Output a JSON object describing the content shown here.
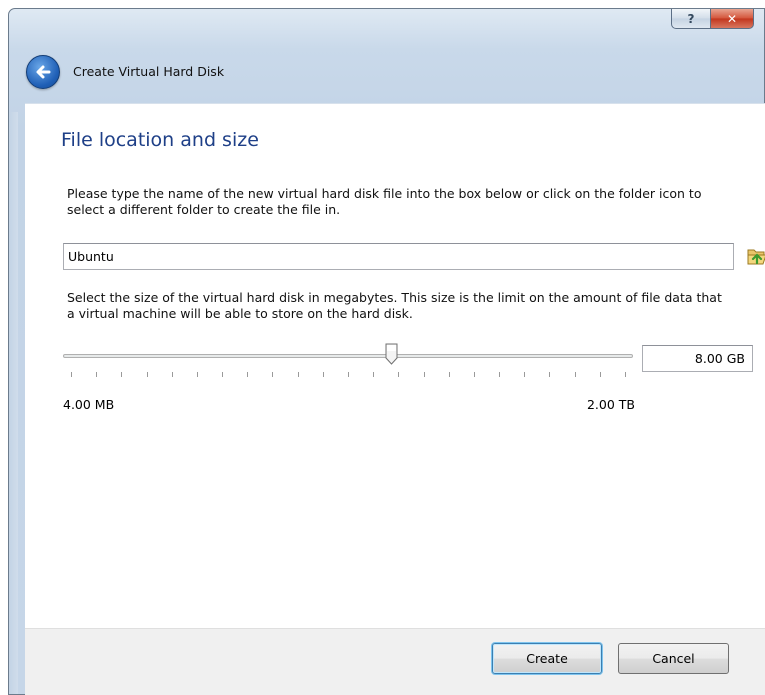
{
  "window": {
    "title": "Create Virtual Hard Disk",
    "help_label": "?",
    "close_label": "✕"
  },
  "page": {
    "title": "File location and size",
    "location_description": "Please type the name of the new virtual hard disk file into the box below or click on the folder icon to select a different folder to create the file in.",
    "file_name": "Ubuntu",
    "size_description": "Select the size of the virtual hard disk in megabytes. This size is the limit on the amount of file data that a virtual machine will be able to store on the hard disk.",
    "size_value": "8.00 GB",
    "size_min_label": "4.00 MB",
    "size_max_label": "2.00 TB",
    "slider_position": 0.575,
    "tick_count": 23
  },
  "footer": {
    "create_label": "Create",
    "cancel_label": "Cancel"
  },
  "colors": {
    "title_blue": "#1e3f87",
    "accent_blue": "#3c7fb1",
    "close_red": "#c2361d"
  },
  "icons": {
    "back": "back-arrow-icon",
    "folder": "folder-open-icon"
  }
}
